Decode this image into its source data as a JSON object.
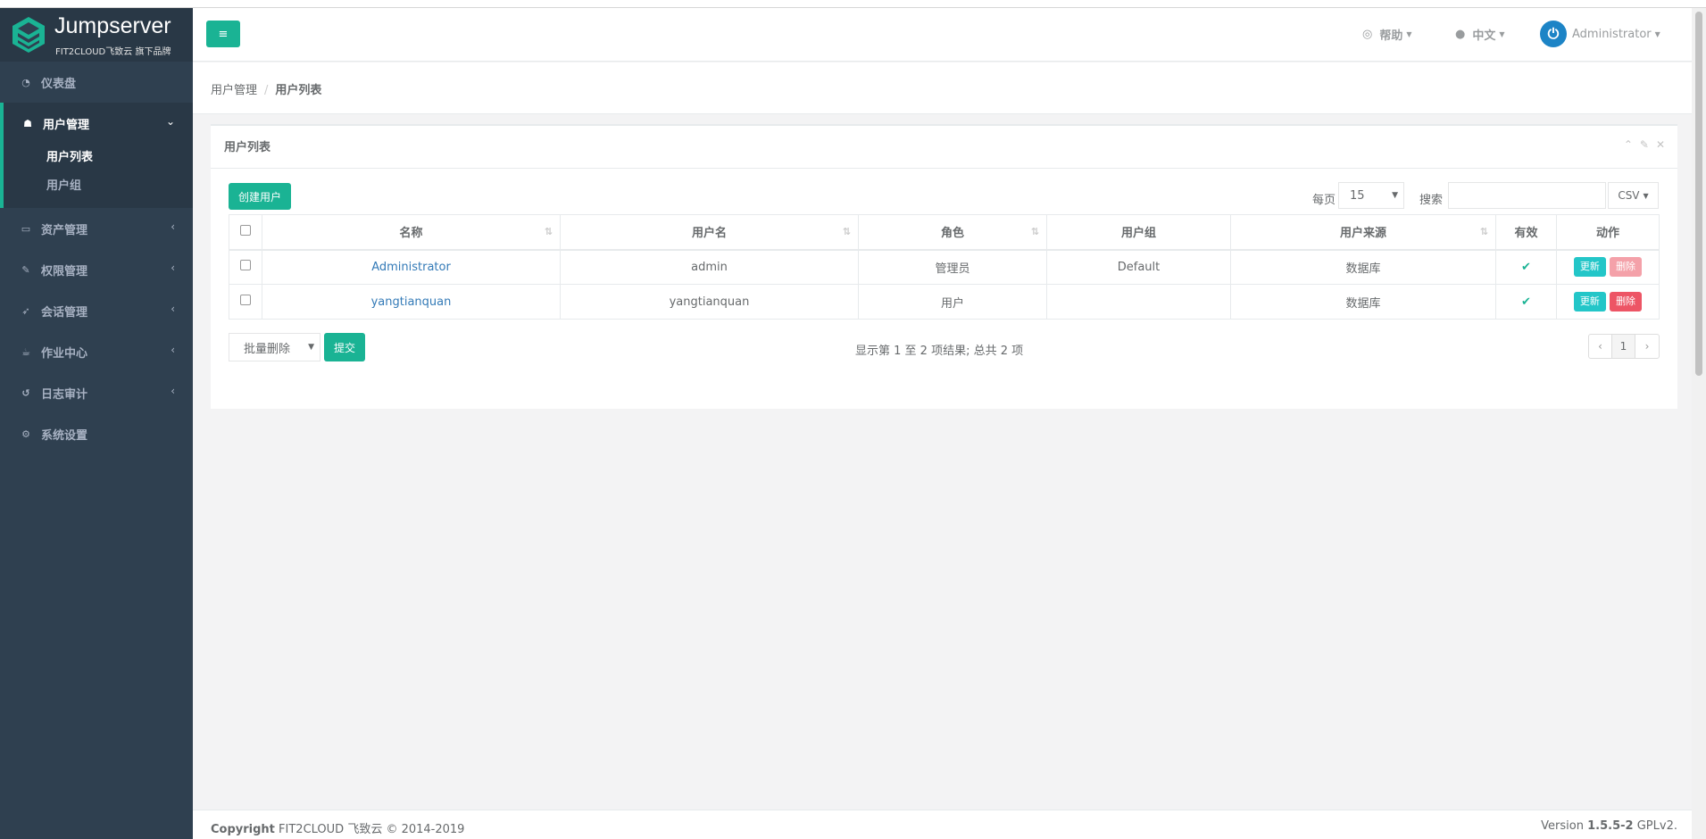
{
  "brand": {
    "title": "Jumpserver",
    "subtitle": "FIT2CLOUD飞致云 旗下品牌"
  },
  "sidebar": {
    "items": [
      {
        "label": "仪表盘",
        "icon": "dashboard-icon"
      },
      {
        "label": "用户管理",
        "icon": "users-icon",
        "expanded": true,
        "children": [
          {
            "label": "用户列表",
            "active": true
          },
          {
            "label": "用户组"
          }
        ]
      },
      {
        "label": "资产管理",
        "icon": "inbox-icon"
      },
      {
        "label": "权限管理",
        "icon": "edit-icon"
      },
      {
        "label": "会话管理",
        "icon": "rocket-icon"
      },
      {
        "label": "作业中心",
        "icon": "coffee-icon"
      },
      {
        "label": "日志审计",
        "icon": "history-icon"
      },
      {
        "label": "系统设置",
        "icon": "cogs-icon"
      }
    ]
  },
  "header": {
    "help": "帮助",
    "language": "中文",
    "user": "Administrator"
  },
  "breadcrumb": {
    "parent": "用户管理",
    "current": "用户列表"
  },
  "panel": {
    "title": "用户列表",
    "create_button": "创建用户",
    "per_page_label": "每页",
    "per_page_value": "15",
    "search_label": "搜索",
    "search_value": "",
    "export": "CSV"
  },
  "table": {
    "columns": [
      "名称",
      "用户名",
      "角色",
      "用户组",
      "用户来源",
      "有效",
      "动作"
    ],
    "rows": [
      {
        "name": "Administrator",
        "username": "admin",
        "role": "管理员",
        "group": "Default",
        "source": "数据库",
        "update": "更新",
        "delete": "删除"
      },
      {
        "name": "yangtianquan",
        "username": "yangtianquan",
        "role": "用户",
        "group": "",
        "source": "数据库",
        "update": "更新",
        "delete": "删除"
      }
    ]
  },
  "bulk": {
    "action": "批量删除",
    "submit": "提交"
  },
  "pagination": {
    "summary": "显示第 1 至 2 项结果; 总共 2 项",
    "prev": "‹",
    "page": "1",
    "next": "›"
  },
  "footer": {
    "copyright_label": "Copyright",
    "copyright_text": "FIT2CLOUD 飞致云 © 2014-2019",
    "version_label": "Version",
    "version_number": "1.5.5-2",
    "license": "GPLv2."
  },
  "colors": {
    "primary": "#1ab394",
    "sidebar": "#2f4050",
    "info": "#23c6c8",
    "danger": "#ed5565",
    "link": "#337ab7"
  }
}
